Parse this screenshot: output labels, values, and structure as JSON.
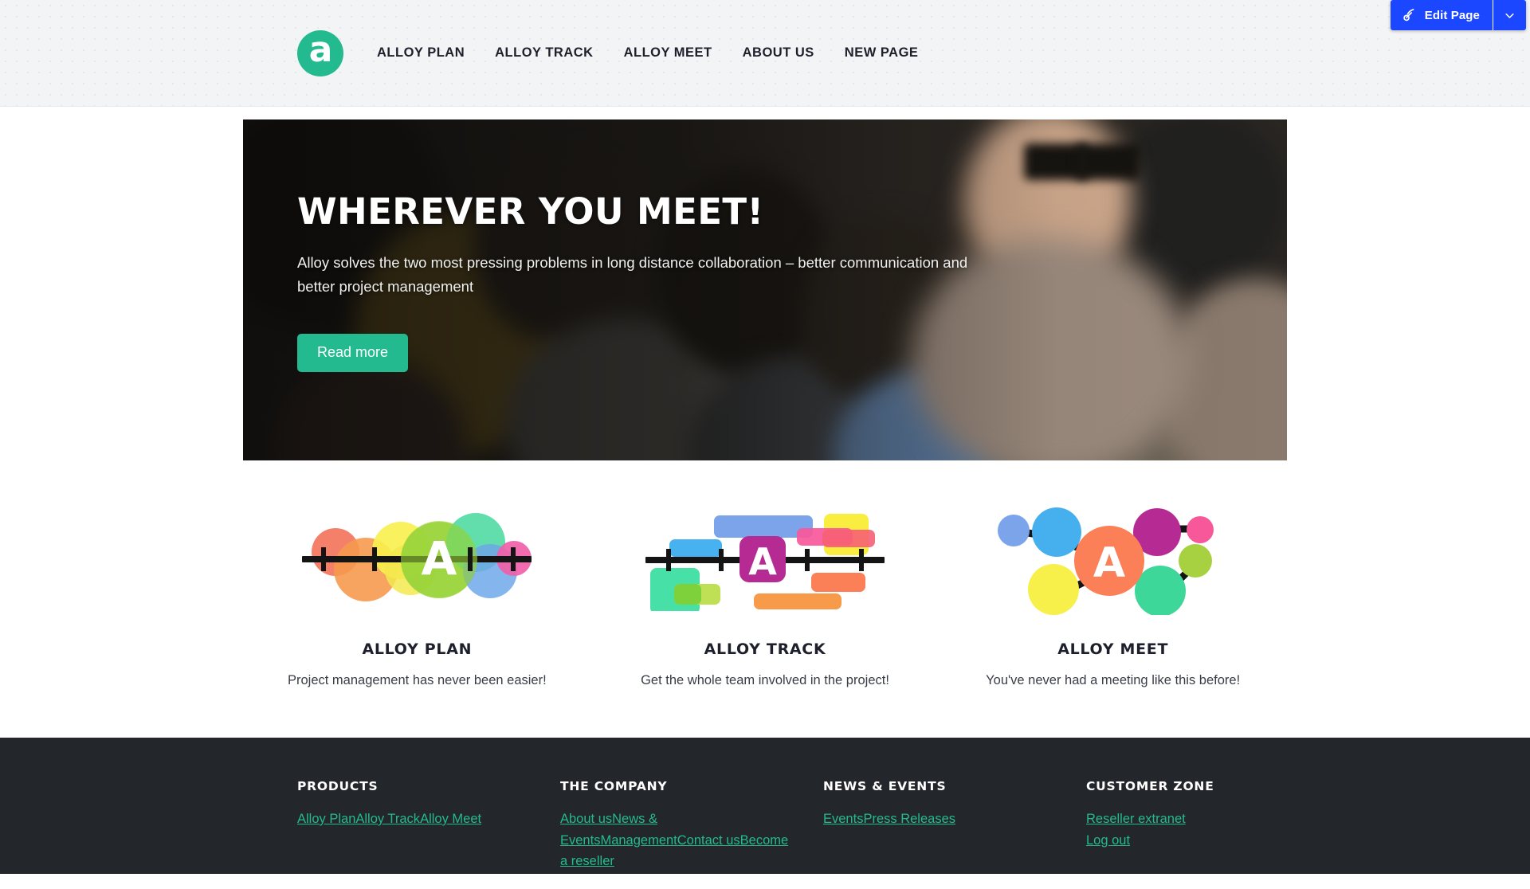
{
  "editor": {
    "edit_page_label": "Edit Page",
    "pencil_icon": "pencil-edit-icon",
    "caret_icon": "chevron-down-icon",
    "accent_color": "#1a47ff"
  },
  "header": {
    "logo_letter": "a",
    "logo_color": "#24ba8f",
    "nav": [
      {
        "label": "ALLOY PLAN"
      },
      {
        "label": "ALLOY TRACK"
      },
      {
        "label": "ALLOY MEET"
      },
      {
        "label": "ABOUT US"
      },
      {
        "label": "NEW PAGE"
      }
    ]
  },
  "hero": {
    "title": "WHEREVER YOU MEET!",
    "subtitle": "Alloy solves the two most pressing problems in long distance collaboration – better communication and better project management",
    "cta_label": "Read more",
    "cta_color": "#24ba8f"
  },
  "products": [
    {
      "art": "alloy-plan-icon",
      "title": "ALLOY PLAN",
      "desc": "Project management has never been easier!"
    },
    {
      "art": "alloy-track-icon",
      "title": "ALLOY TRACK",
      "desc": "Get the whole team involved in the project!"
    },
    {
      "art": "alloy-meet-icon",
      "title": "ALLOY MEET",
      "desc": "You've never had a meeting like this before!"
    }
  ],
  "footer": {
    "link_color": "#24ba8f",
    "background": "#23262b",
    "columns": [
      {
        "title": "PRODUCTS",
        "links": [
          {
            "label": "Alloy Plan"
          },
          {
            "label": "Alloy Track"
          },
          {
            "label": "Alloy Meet"
          }
        ]
      },
      {
        "title": "THE COMPANY",
        "links": [
          {
            "label": "About us"
          },
          {
            "label": "News & Events"
          },
          {
            "label": "Management"
          },
          {
            "label": "Contact us"
          },
          {
            "label": "Become a reseller"
          }
        ]
      },
      {
        "title": "NEWS & EVENTS",
        "links": [
          {
            "label": "Events"
          },
          {
            "label": "Press Releases"
          }
        ]
      },
      {
        "title": "CUSTOMER ZONE",
        "links": [
          {
            "label": "Reseller extranet"
          },
          {
            "label": "Log out"
          }
        ]
      }
    ]
  }
}
